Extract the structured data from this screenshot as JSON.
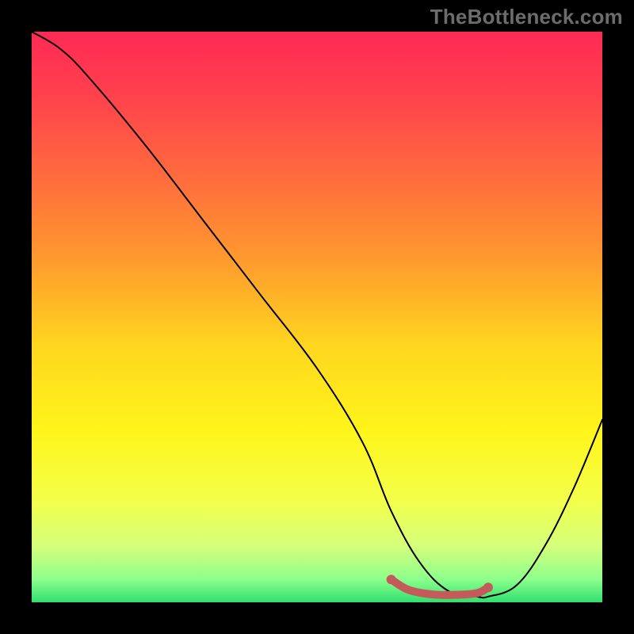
{
  "watermark": "TheBottleneck.com",
  "chart_data": {
    "type": "line",
    "title": "",
    "xlabel": "",
    "ylabel": "",
    "xlim": [
      0,
      100
    ],
    "ylim": [
      0,
      100
    ],
    "gradient_stops": [
      {
        "offset": 0.0,
        "color": "#FF2A55"
      },
      {
        "offset": 0.1,
        "color": "#FF3E4E"
      },
      {
        "offset": 0.25,
        "color": "#FF6A3E"
      },
      {
        "offset": 0.4,
        "color": "#FF9A2E"
      },
      {
        "offset": 0.55,
        "color": "#FFD61F"
      },
      {
        "offset": 0.7,
        "color": "#FFF51A"
      },
      {
        "offset": 0.82,
        "color": "#F4FF4A"
      },
      {
        "offset": 0.9,
        "color": "#D6FF7A"
      },
      {
        "offset": 0.96,
        "color": "#8CFF8C"
      },
      {
        "offset": 1.0,
        "color": "#30E070"
      }
    ],
    "series": [
      {
        "name": "bottleneck-curve",
        "x": [
          0,
          5,
          10,
          20,
          30,
          40,
          50,
          58,
          63,
          68,
          73,
          78,
          80,
          85,
          90,
          95,
          100
        ],
        "y": [
          100,
          97,
          92,
          80,
          67,
          54,
          41,
          28,
          16,
          7,
          2,
          1,
          1,
          3,
          10,
          20,
          32
        ]
      }
    ],
    "highlight": {
      "name": "optimal-band",
      "color": "#C45A5A",
      "x": [
        63,
        66,
        70,
        74,
        78,
        80
      ],
      "y": [
        4,
        2.2,
        1.4,
        1.3,
        1.6,
        2.6
      ]
    }
  }
}
